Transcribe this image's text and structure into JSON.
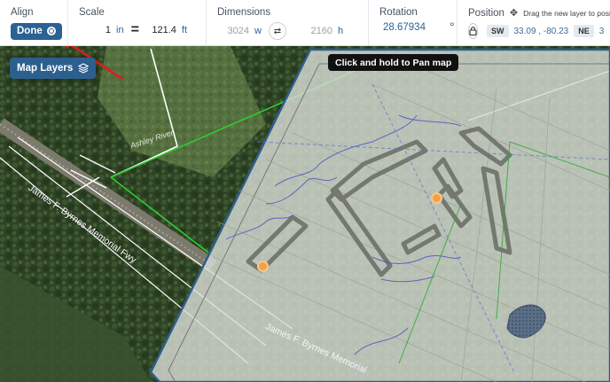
{
  "toolbar": {
    "align": {
      "title": "Align",
      "done_label": "Done"
    },
    "scale": {
      "title": "Scale",
      "left_value": "1",
      "left_unit": "in",
      "equals": "=",
      "right_value": "121.4",
      "right_unit": "ft"
    },
    "dimensions": {
      "title": "Dimensions",
      "width": "3024",
      "width_unit": "w",
      "height": "2160",
      "height_unit": "h"
    },
    "rotation": {
      "title": "Rotation",
      "value": "28.67934",
      "unit": "°"
    },
    "position": {
      "title": "Position",
      "hint": "Drag the new layer to posit",
      "sw_label": "SW",
      "sw_coords": "33.09 , -80.23",
      "ne_label": "NE",
      "ne_coords": "3"
    }
  },
  "map": {
    "layers_button": "Map Layers",
    "pan_tooltip": "Click and hold to Pan map",
    "road_label_left": "James F. Byrnes Memorial Fwy",
    "road_label_bottom": "James F. Byrnes Memorial",
    "river_label": "Ashley River",
    "pin_1": "5",
    "pin_2": "5"
  },
  "colors": {
    "accent": "#2a6294",
    "overlay_border": "#2d5f8e",
    "guide_green": "#2fcc2f",
    "arrow_red": "#e01b1b"
  },
  "icons": [
    "target-icon",
    "swap-icon",
    "move-icon",
    "lock-icon",
    "layers-icon",
    "red-arrow"
  ]
}
